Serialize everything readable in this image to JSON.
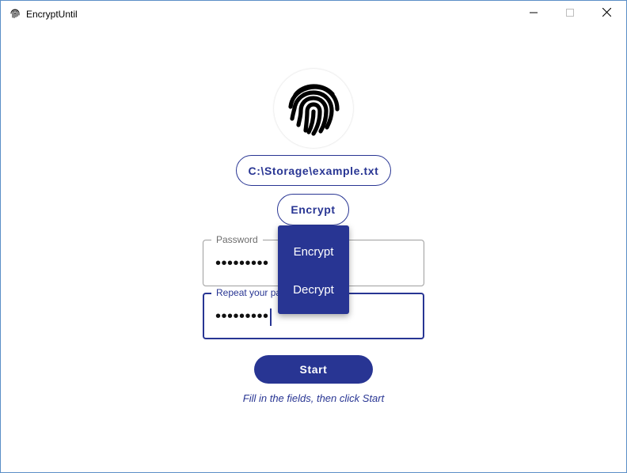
{
  "window": {
    "title": "EncryptUntil",
    "icon": "fingerprint-icon",
    "controls": [
      "minimize-icon",
      "maximize-icon",
      "close-icon"
    ]
  },
  "logo": {
    "icon": "fingerprint-icon"
  },
  "file_path": "C:\\Storage\\example.txt",
  "mode": {
    "selected": "Encrypt",
    "options": [
      "Encrypt",
      "Decrypt"
    ]
  },
  "password": {
    "label": "Password",
    "value": "•••••••••"
  },
  "repeat_password": {
    "label": "Repeat your password",
    "value": "•••••••••"
  },
  "start_label": "Start",
  "hint": "Fill in the fields, then click Start",
  "colors": {
    "accent": "#283593",
    "window_border": "#5b8fc7",
    "field_border": "#9e9e9e"
  }
}
